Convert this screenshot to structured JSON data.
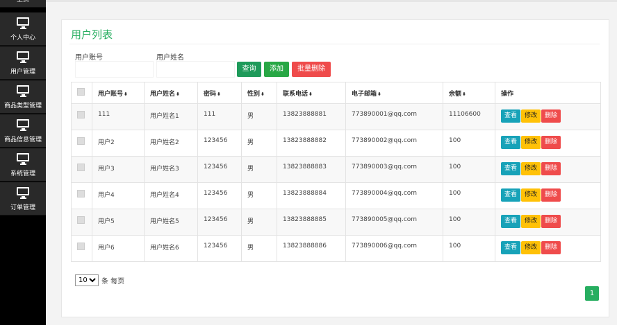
{
  "sidebar": {
    "items": [
      {
        "label": "主页",
        "icon": "monitor-icon"
      },
      {
        "label": "个人中心",
        "icon": "monitor-icon"
      },
      {
        "label": "用户管理",
        "icon": "monitor-icon"
      },
      {
        "label": "商品类型管理",
        "icon": "monitor-icon"
      },
      {
        "label": "商品信息管理",
        "icon": "monitor-icon"
      },
      {
        "label": "系统管理",
        "icon": "monitor-icon"
      },
      {
        "label": "订单管理",
        "icon": "monitor-icon"
      }
    ]
  },
  "page": {
    "title": "用户列表"
  },
  "search": {
    "account_label": "用户账号",
    "account_value": "",
    "name_label": "用户姓名",
    "name_value": "",
    "query_button": "查询",
    "add_button": "添加",
    "batch_delete_button": "批量删除"
  },
  "table": {
    "headers": [
      "用户账号",
      "用户姓名",
      "密码",
      "性别",
      "联系电话",
      "电子邮箱",
      "余额",
      "操作"
    ],
    "actions": {
      "view": "查看",
      "edit": "修改",
      "delete": "删除"
    },
    "rows": [
      {
        "account": "111",
        "name": "用户姓名1",
        "password": "111",
        "gender": "男",
        "phone": "13823888881",
        "email": "773890001@qq.com",
        "balance": "11106600"
      },
      {
        "account": "用户2",
        "name": "用户姓名2",
        "password": "123456",
        "gender": "男",
        "phone": "13823888882",
        "email": "773890002@qq.com",
        "balance": "100"
      },
      {
        "account": "用户3",
        "name": "用户姓名3",
        "password": "123456",
        "gender": "男",
        "phone": "13823888883",
        "email": "773890003@qq.com",
        "balance": "100"
      },
      {
        "account": "用户4",
        "name": "用户姓名4",
        "password": "123456",
        "gender": "男",
        "phone": "13823888884",
        "email": "773890004@qq.com",
        "balance": "100"
      },
      {
        "account": "用户5",
        "name": "用户姓名5",
        "password": "123456",
        "gender": "男",
        "phone": "13823888885",
        "email": "773890005@qq.com",
        "balance": "100"
      },
      {
        "account": "用户6",
        "name": "用户姓名6",
        "password": "123456",
        "gender": "男",
        "phone": "13823888886",
        "email": "773890006@qq.com",
        "balance": "100"
      }
    ]
  },
  "pagination": {
    "page_size": "10",
    "per_page_label": "条 每页",
    "current_page": "1"
  },
  "colors": {
    "accent": "#27ae60",
    "view": "#17a2b8",
    "edit": "#ffc107",
    "delete": "#ef4b4b"
  }
}
